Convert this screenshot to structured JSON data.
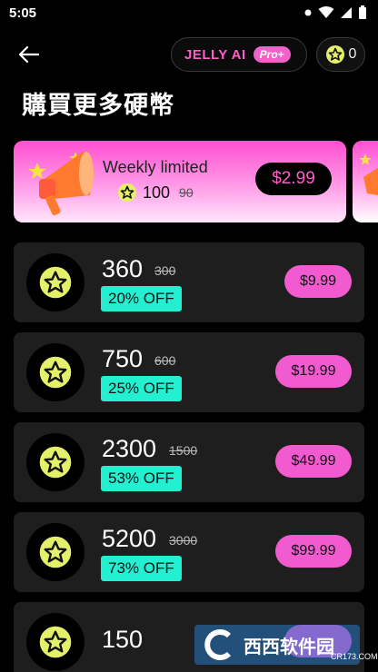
{
  "status": {
    "time": "5:05"
  },
  "header": {
    "brand": "JELLY AI",
    "pro_badge": "Pro+",
    "coin_count": "0"
  },
  "title": "購買更多硬幣",
  "promo": {
    "label": "Weekly limited",
    "coins": "100",
    "old_coins": "90",
    "price": "$2.99"
  },
  "packages": [
    {
      "coins": "360",
      "old": "300",
      "discount": "20% OFF",
      "price": "$9.99"
    },
    {
      "coins": "750",
      "old": "600",
      "discount": "25% OFF",
      "price": "$19.99"
    },
    {
      "coins": "2300",
      "old": "1500",
      "discount": "53% OFF",
      "price": "$49.99"
    },
    {
      "coins": "5200",
      "old": "3000",
      "discount": "73% OFF",
      "price": "$99.99"
    },
    {
      "coins": "150"
    }
  ],
  "watermark": {
    "text": "西西软件园",
    "sub": "CR173.COM"
  },
  "colors": {
    "accent_pink": "#f25ad0",
    "discount_teal": "#22f0d0",
    "coin_yellow": "#e4f06a"
  }
}
